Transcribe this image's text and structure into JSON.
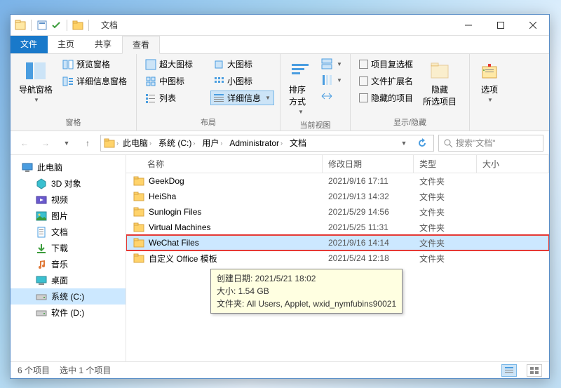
{
  "title": "文档",
  "tabs": {
    "file": "文件",
    "home": "主页",
    "share": "共享",
    "view": "查看"
  },
  "ribbon": {
    "panes": {
      "nav": "导航窗格",
      "preview": "预览窗格",
      "detailsPane": "详细信息窗格"
    },
    "panes_label": "窗格",
    "layout": {
      "xl": "超大图标",
      "lg": "大图标",
      "md": "中图标",
      "sm": "小图标",
      "list": "列表",
      "details": "详细信息"
    },
    "layout_label": "布局",
    "currentview": {
      "sort": "排序方式"
    },
    "currentview_label": "当前视图",
    "showhide": {
      "chk1": "项目复选框",
      "chk2": "文件扩展名",
      "chk3": "隐藏的项目",
      "hide": "隐藏\n所选项目"
    },
    "showhide_label": "显示/隐藏",
    "options": "选项"
  },
  "breadcrumb": [
    "此电脑",
    "系统 (C:)",
    "用户",
    "Administrator",
    "文档"
  ],
  "search_placeholder": "搜索\"文档\"",
  "nav": [
    {
      "label": "此电脑",
      "icon": "pc",
      "sel": false,
      "sub": false
    },
    {
      "label": "3D 对象",
      "icon": "3d",
      "sel": false,
      "sub": true
    },
    {
      "label": "视频",
      "icon": "video",
      "sel": false,
      "sub": true
    },
    {
      "label": "图片",
      "icon": "pic",
      "sel": false,
      "sub": true
    },
    {
      "label": "文档",
      "icon": "doc",
      "sel": false,
      "sub": true
    },
    {
      "label": "下载",
      "icon": "dl",
      "sel": false,
      "sub": true
    },
    {
      "label": "音乐",
      "icon": "music",
      "sel": false,
      "sub": true
    },
    {
      "label": "桌面",
      "icon": "desk",
      "sel": false,
      "sub": true
    },
    {
      "label": "系统 (C:)",
      "icon": "drive",
      "sel": true,
      "sub": true
    },
    {
      "label": "软件 (D:)",
      "icon": "drive",
      "sel": false,
      "sub": true
    }
  ],
  "columns": {
    "name": "名称",
    "date": "修改日期",
    "type": "类型",
    "size": "大小"
  },
  "files": [
    {
      "name": "GeekDog",
      "date": "2021/9/16 17:11",
      "type": "文件夹"
    },
    {
      "name": "HeiSha",
      "date": "2021/9/13 14:32",
      "type": "文件夹"
    },
    {
      "name": "Sunlogin Files",
      "date": "2021/5/29 14:56",
      "type": "文件夹"
    },
    {
      "name": "Virtual Machines",
      "date": "2021/5/25 11:31",
      "type": "文件夹"
    },
    {
      "name": "WeChat Files",
      "date": "2021/9/16 14:14",
      "type": "文件夹",
      "sel": true,
      "hl": true
    },
    {
      "name": "自定义 Office 模板",
      "date": "2021/5/24 12:18",
      "type": "文件夹"
    }
  ],
  "tooltip": {
    "l1": "创建日期: 2021/5/21 18:02",
    "l2": "大小: 1.54 GB",
    "l3": "文件夹: All Users, Applet, wxid_nymfubins90021"
  },
  "status": {
    "count": "6 个项目",
    "sel": "选中 1 个项目"
  }
}
